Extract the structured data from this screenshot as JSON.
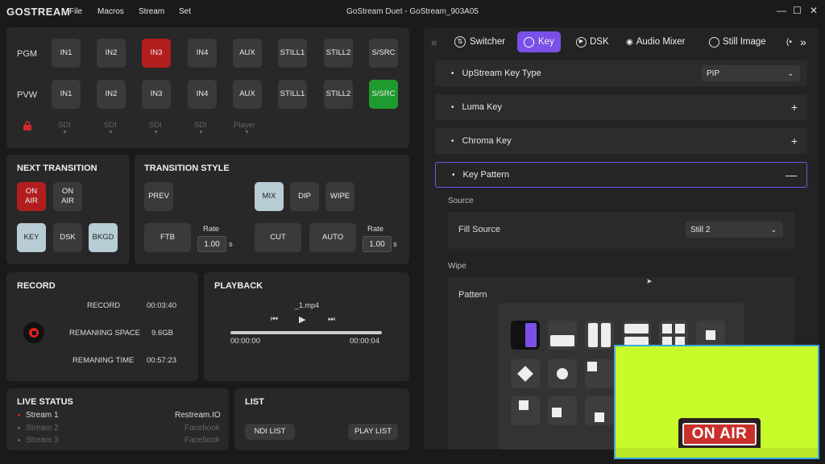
{
  "app": {
    "logo": "GOSTREAM",
    "menu": [
      "File",
      "Macros",
      "Stream",
      "Set"
    ],
    "window_title": "GoStream Duet - GoStream_903A05"
  },
  "switcher": {
    "pgm_label": "PGM",
    "pvw_label": "PVW",
    "pgm_buttons": [
      "IN1",
      "IN2",
      "IN3",
      "IN4",
      "AUX",
      "STILL1",
      "STILL2",
      "S/SRC"
    ],
    "pvw_buttons": [
      "IN1",
      "IN2",
      "IN3",
      "IN4",
      "AUX",
      "STILL1",
      "STILL2",
      "S/SRC"
    ],
    "sources": [
      "SDI",
      "SDI",
      "SDI",
      "SDI",
      "Player"
    ],
    "pgm_active": "IN3",
    "pvw_active": "S/SRC"
  },
  "next_transition": {
    "title": "NEXT TRANSITION",
    "on_air_1": "ON AIR",
    "on_air_2": "ON AIR",
    "key": "KEY",
    "dsk": "DSK",
    "bkgd": "BKGD"
  },
  "transition_style": {
    "title": "TRANSITION STYLE",
    "prev": "PREV",
    "mix": "MIX",
    "dip": "DIP",
    "wipe": "WIPE",
    "ftb": "FTB",
    "cut": "CUT",
    "auto": "AUTO",
    "rate_label_1": "Rate",
    "rate_value_1": "1.00",
    "rate_unit_1": "s",
    "rate_label_2": "Rate",
    "rate_value_2": "1.00",
    "rate_unit_2": "s"
  },
  "record": {
    "title": "RECORD",
    "record_label": "RECORD",
    "record_value": "00:03:40",
    "space_label": "REMANIING SPACE",
    "space_value": "9.6GB",
    "time_label": "REMANING TIME",
    "time_value": "00:57:23"
  },
  "playback": {
    "title": "PLAYBACK",
    "file": "_1.mp4",
    "elapsed": "00:00:00",
    "duration": "00:00:04",
    "progress": 0
  },
  "live_status": {
    "title": "LIVE STATUS",
    "streams": [
      {
        "name": "Stream 1",
        "platform": "Restream.IO"
      },
      {
        "name": "Stream 2",
        "platform": "Facebook"
      },
      {
        "name": "Stream 3",
        "platform": "Facebook"
      }
    ]
  },
  "list": {
    "title": "LIST",
    "ndi": "NDI LIST",
    "play": "PLAY LIST"
  },
  "tabs": [
    "Switcher",
    "Key",
    "DSK",
    "Audio Mixer",
    "Still Image"
  ],
  "active_tab": "Key",
  "key_panel": {
    "upstream_label": "UpStream Key Type",
    "upstream_value": "PIP",
    "luma": "Luma Key",
    "chroma": "Chroma Key",
    "pattern": "Key Pattern",
    "source_section": "Source",
    "fill_label": "Fill Source",
    "fill_value": "Still 2",
    "wipe_section": "Wipe",
    "pattern_label": "Pattern"
  },
  "preview": {
    "sign_text": "ON AIR"
  },
  "colors": {
    "accent": "#7a50e8",
    "pgm_red": "#b21e1e",
    "pvw_green": "#1f9a2e",
    "preview_bg": "#c8fb2a"
  }
}
